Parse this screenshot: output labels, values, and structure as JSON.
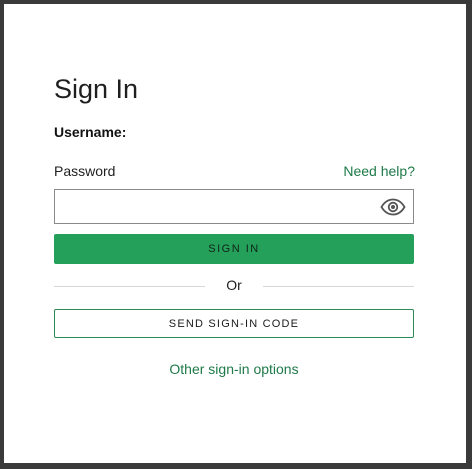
{
  "form": {
    "title": "Sign In",
    "username_label": "Username:",
    "password_label": "Password",
    "help_link": "Need help?",
    "password_value": "",
    "password_placeholder": "",
    "show_password_icon": "eye-icon",
    "signin_button": "SIGN IN",
    "divider_text": "Or",
    "code_button": "SEND SIGN-IN CODE",
    "other_options_link": "Other sign-in options"
  },
  "colors": {
    "primary": "#25a05a",
    "link": "#1e7a48",
    "outline": "#2f8a57",
    "frame": "#3a3a3a"
  }
}
